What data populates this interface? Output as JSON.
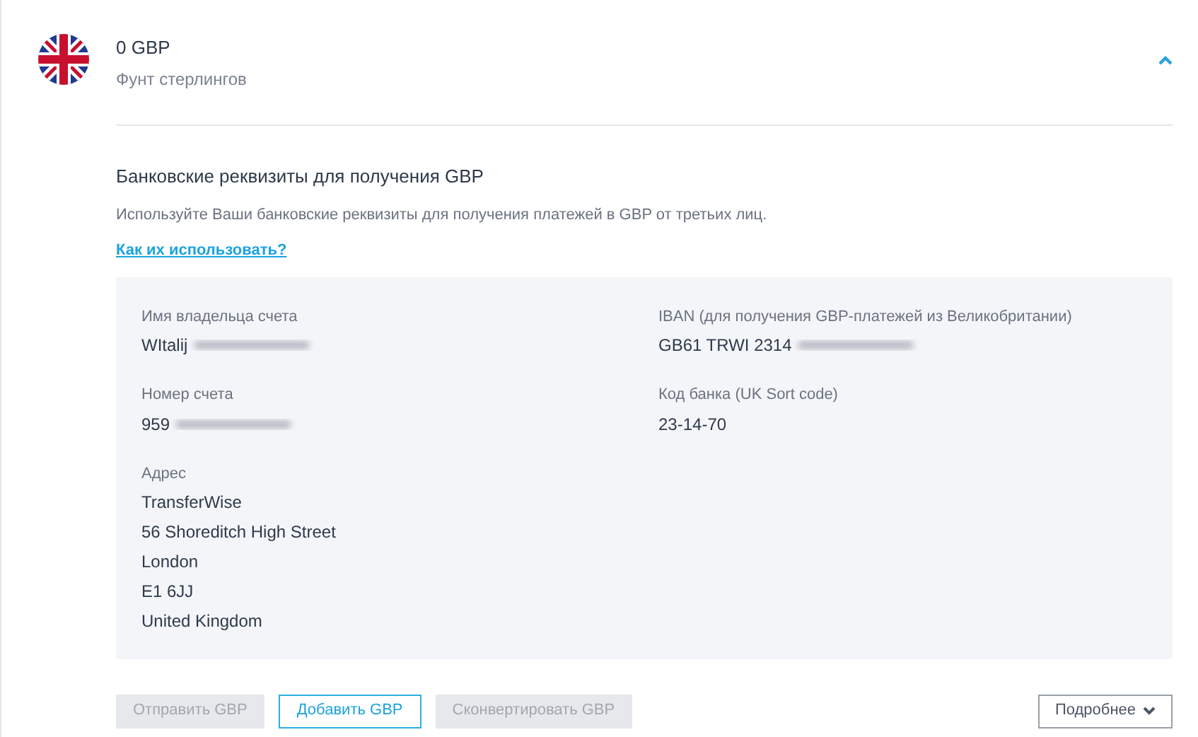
{
  "currency": {
    "amount": "0 GBP",
    "name": "Фунт стерлингов",
    "expanded": true
  },
  "details": {
    "title": "Банковские реквизиты для получения GBP",
    "description": "Используйте Ваши банковские реквизиты для получения платежей в GBP от третьих лиц.",
    "link": "Как их использовать?",
    "fields": [
      {
        "label": "Имя владельца счета",
        "value": "WItalij",
        "redacted": true
      },
      {
        "label": "IBAN (для получения GBP-платежей из Великобритании)",
        "value": "GB61 TRWI 2314",
        "redacted": true
      },
      {
        "label": "Номер счета",
        "value": "959",
        "redacted": true
      },
      {
        "label": "Код банка (UK Sort code)",
        "value": "23-14-70",
        "redacted": false
      }
    ],
    "address": {
      "label": "Адрес",
      "lines": [
        "TransferWise",
        "56 Shoreditch High Street",
        "London",
        "E1 6JJ",
        "United Kingdom"
      ]
    }
  },
  "actions": [
    {
      "label": "Отправить GBP",
      "disabled": true
    },
    {
      "label": "Добавить GBP",
      "disabled": false
    },
    {
      "label": "Сконвертировать GBP",
      "disabled": true
    }
  ],
  "more_button": {
    "label": "Подробнее"
  }
}
